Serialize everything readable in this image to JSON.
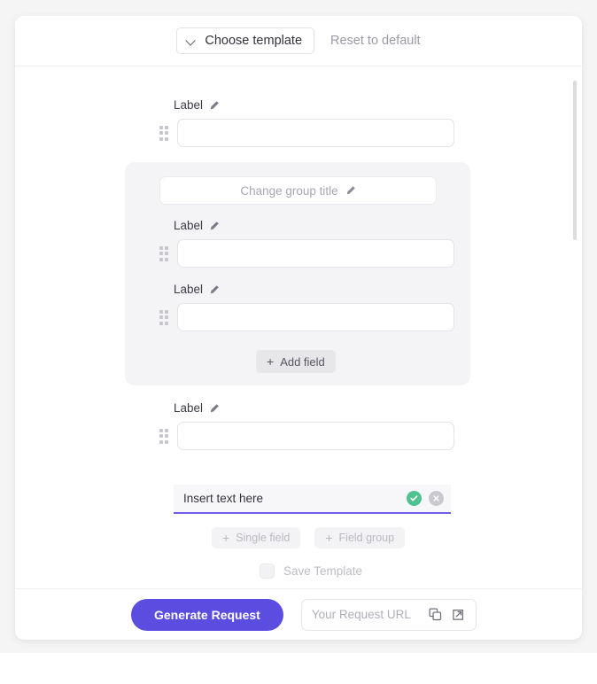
{
  "header": {
    "choose_template_label": "Choose template",
    "reset_label": "Reset to default",
    "chevron_icon": "chevron-down-icon"
  },
  "fields": [
    {
      "label": "Label",
      "value": "",
      "edit_icon": "pencil-icon",
      "drag_icon": "drag-handle-icon"
    },
    {
      "label": "Label",
      "value": "",
      "edit_icon": "pencil-icon",
      "drag_icon": "drag-handle-icon"
    },
    {
      "label": "Label",
      "value": "",
      "edit_icon": "pencil-icon",
      "drag_icon": "drag-handle-icon"
    },
    {
      "label": "Label",
      "value": "",
      "edit_icon": "pencil-icon",
      "drag_icon": "drag-handle-icon"
    }
  ],
  "group": {
    "title_placeholder": "Change group title",
    "title_edit_icon": "pencil-icon",
    "add_field_label": "Add field",
    "add_field_icon": "plus-icon"
  },
  "insert_row": {
    "text": "Insert text here",
    "confirm_icon": "check-circle-icon",
    "cancel_icon": "close-circle-icon",
    "underline_color": "#6c5ce7"
  },
  "add_buttons": [
    {
      "label": "Single field",
      "icon": "plus-icon"
    },
    {
      "label": "Field group",
      "icon": "plus-icon"
    }
  ],
  "save_template": {
    "label": "Save Template",
    "checked": false
  },
  "footer": {
    "generate_label": "Generate Request",
    "url_placeholder": "Your Request URL",
    "copy_icon": "copy-icon",
    "open_external_icon": "external-link-icon",
    "accent_color": "#5b4de0"
  },
  "scrollbar": {
    "name": "vertical-scrollbar"
  }
}
